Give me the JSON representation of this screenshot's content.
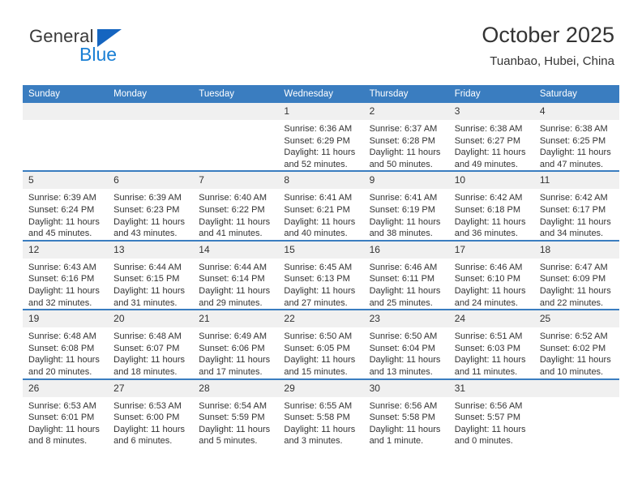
{
  "brand": {
    "name_top": "General",
    "name_bottom": "Blue",
    "triangle_color": "#1565c0",
    "blue_color": "#1a7fd4"
  },
  "header": {
    "title": "October 2025",
    "subtitle": "Tuanbao, Hubei, China"
  },
  "theme": {
    "header_blue": "#3a7dc0",
    "daynum_bg": "#f0f0f0",
    "text": "#333333"
  },
  "weekdays": [
    "Sunday",
    "Monday",
    "Tuesday",
    "Wednesday",
    "Thursday",
    "Friday",
    "Saturday"
  ],
  "labels": {
    "sunrise_prefix": "Sunrise:",
    "sunset_prefix": "Sunset:",
    "daylight_prefix": "Daylight:"
  },
  "weeks": [
    [
      {
        "day": "",
        "empty": true
      },
      {
        "day": "",
        "empty": true
      },
      {
        "day": "",
        "empty": true
      },
      {
        "day": "1",
        "sunrise": "Sunrise: 6:36 AM",
        "sunset": "Sunset: 6:29 PM",
        "daylight": "Daylight: 11 hours and 52 minutes."
      },
      {
        "day": "2",
        "sunrise": "Sunrise: 6:37 AM",
        "sunset": "Sunset: 6:28 PM",
        "daylight": "Daylight: 11 hours and 50 minutes."
      },
      {
        "day": "3",
        "sunrise": "Sunrise: 6:38 AM",
        "sunset": "Sunset: 6:27 PM",
        "daylight": "Daylight: 11 hours and 49 minutes."
      },
      {
        "day": "4",
        "sunrise": "Sunrise: 6:38 AM",
        "sunset": "Sunset: 6:25 PM",
        "daylight": "Daylight: 11 hours and 47 minutes."
      }
    ],
    [
      {
        "day": "5",
        "sunrise": "Sunrise: 6:39 AM",
        "sunset": "Sunset: 6:24 PM",
        "daylight": "Daylight: 11 hours and 45 minutes."
      },
      {
        "day": "6",
        "sunrise": "Sunrise: 6:39 AM",
        "sunset": "Sunset: 6:23 PM",
        "daylight": "Daylight: 11 hours and 43 minutes."
      },
      {
        "day": "7",
        "sunrise": "Sunrise: 6:40 AM",
        "sunset": "Sunset: 6:22 PM",
        "daylight": "Daylight: 11 hours and 41 minutes."
      },
      {
        "day": "8",
        "sunrise": "Sunrise: 6:41 AM",
        "sunset": "Sunset: 6:21 PM",
        "daylight": "Daylight: 11 hours and 40 minutes."
      },
      {
        "day": "9",
        "sunrise": "Sunrise: 6:41 AM",
        "sunset": "Sunset: 6:19 PM",
        "daylight": "Daylight: 11 hours and 38 minutes."
      },
      {
        "day": "10",
        "sunrise": "Sunrise: 6:42 AM",
        "sunset": "Sunset: 6:18 PM",
        "daylight": "Daylight: 11 hours and 36 minutes."
      },
      {
        "day": "11",
        "sunrise": "Sunrise: 6:42 AM",
        "sunset": "Sunset: 6:17 PM",
        "daylight": "Daylight: 11 hours and 34 minutes."
      }
    ],
    [
      {
        "day": "12",
        "sunrise": "Sunrise: 6:43 AM",
        "sunset": "Sunset: 6:16 PM",
        "daylight": "Daylight: 11 hours and 32 minutes."
      },
      {
        "day": "13",
        "sunrise": "Sunrise: 6:44 AM",
        "sunset": "Sunset: 6:15 PM",
        "daylight": "Daylight: 11 hours and 31 minutes."
      },
      {
        "day": "14",
        "sunrise": "Sunrise: 6:44 AM",
        "sunset": "Sunset: 6:14 PM",
        "daylight": "Daylight: 11 hours and 29 minutes."
      },
      {
        "day": "15",
        "sunrise": "Sunrise: 6:45 AM",
        "sunset": "Sunset: 6:13 PM",
        "daylight": "Daylight: 11 hours and 27 minutes."
      },
      {
        "day": "16",
        "sunrise": "Sunrise: 6:46 AM",
        "sunset": "Sunset: 6:11 PM",
        "daylight": "Daylight: 11 hours and 25 minutes."
      },
      {
        "day": "17",
        "sunrise": "Sunrise: 6:46 AM",
        "sunset": "Sunset: 6:10 PM",
        "daylight": "Daylight: 11 hours and 24 minutes."
      },
      {
        "day": "18",
        "sunrise": "Sunrise: 6:47 AM",
        "sunset": "Sunset: 6:09 PM",
        "daylight": "Daylight: 11 hours and 22 minutes."
      }
    ],
    [
      {
        "day": "19",
        "sunrise": "Sunrise: 6:48 AM",
        "sunset": "Sunset: 6:08 PM",
        "daylight": "Daylight: 11 hours and 20 minutes."
      },
      {
        "day": "20",
        "sunrise": "Sunrise: 6:48 AM",
        "sunset": "Sunset: 6:07 PM",
        "daylight": "Daylight: 11 hours and 18 minutes."
      },
      {
        "day": "21",
        "sunrise": "Sunrise: 6:49 AM",
        "sunset": "Sunset: 6:06 PM",
        "daylight": "Daylight: 11 hours and 17 minutes."
      },
      {
        "day": "22",
        "sunrise": "Sunrise: 6:50 AM",
        "sunset": "Sunset: 6:05 PM",
        "daylight": "Daylight: 11 hours and 15 minutes."
      },
      {
        "day": "23",
        "sunrise": "Sunrise: 6:50 AM",
        "sunset": "Sunset: 6:04 PM",
        "daylight": "Daylight: 11 hours and 13 minutes."
      },
      {
        "day": "24",
        "sunrise": "Sunrise: 6:51 AM",
        "sunset": "Sunset: 6:03 PM",
        "daylight": "Daylight: 11 hours and 11 minutes."
      },
      {
        "day": "25",
        "sunrise": "Sunrise: 6:52 AM",
        "sunset": "Sunset: 6:02 PM",
        "daylight": "Daylight: 11 hours and 10 minutes."
      }
    ],
    [
      {
        "day": "26",
        "sunrise": "Sunrise: 6:53 AM",
        "sunset": "Sunset: 6:01 PM",
        "daylight": "Daylight: 11 hours and 8 minutes."
      },
      {
        "day": "27",
        "sunrise": "Sunrise: 6:53 AM",
        "sunset": "Sunset: 6:00 PM",
        "daylight": "Daylight: 11 hours and 6 minutes."
      },
      {
        "day": "28",
        "sunrise": "Sunrise: 6:54 AM",
        "sunset": "Sunset: 5:59 PM",
        "daylight": "Daylight: 11 hours and 5 minutes."
      },
      {
        "day": "29",
        "sunrise": "Sunrise: 6:55 AM",
        "sunset": "Sunset: 5:58 PM",
        "daylight": "Daylight: 11 hours and 3 minutes."
      },
      {
        "day": "30",
        "sunrise": "Sunrise: 6:56 AM",
        "sunset": "Sunset: 5:58 PM",
        "daylight": "Daylight: 11 hours and 1 minute."
      },
      {
        "day": "31",
        "sunrise": "Sunrise: 6:56 AM",
        "sunset": "Sunset: 5:57 PM",
        "daylight": "Daylight: 11 hours and 0 minutes."
      },
      {
        "day": "",
        "empty": true
      }
    ]
  ]
}
